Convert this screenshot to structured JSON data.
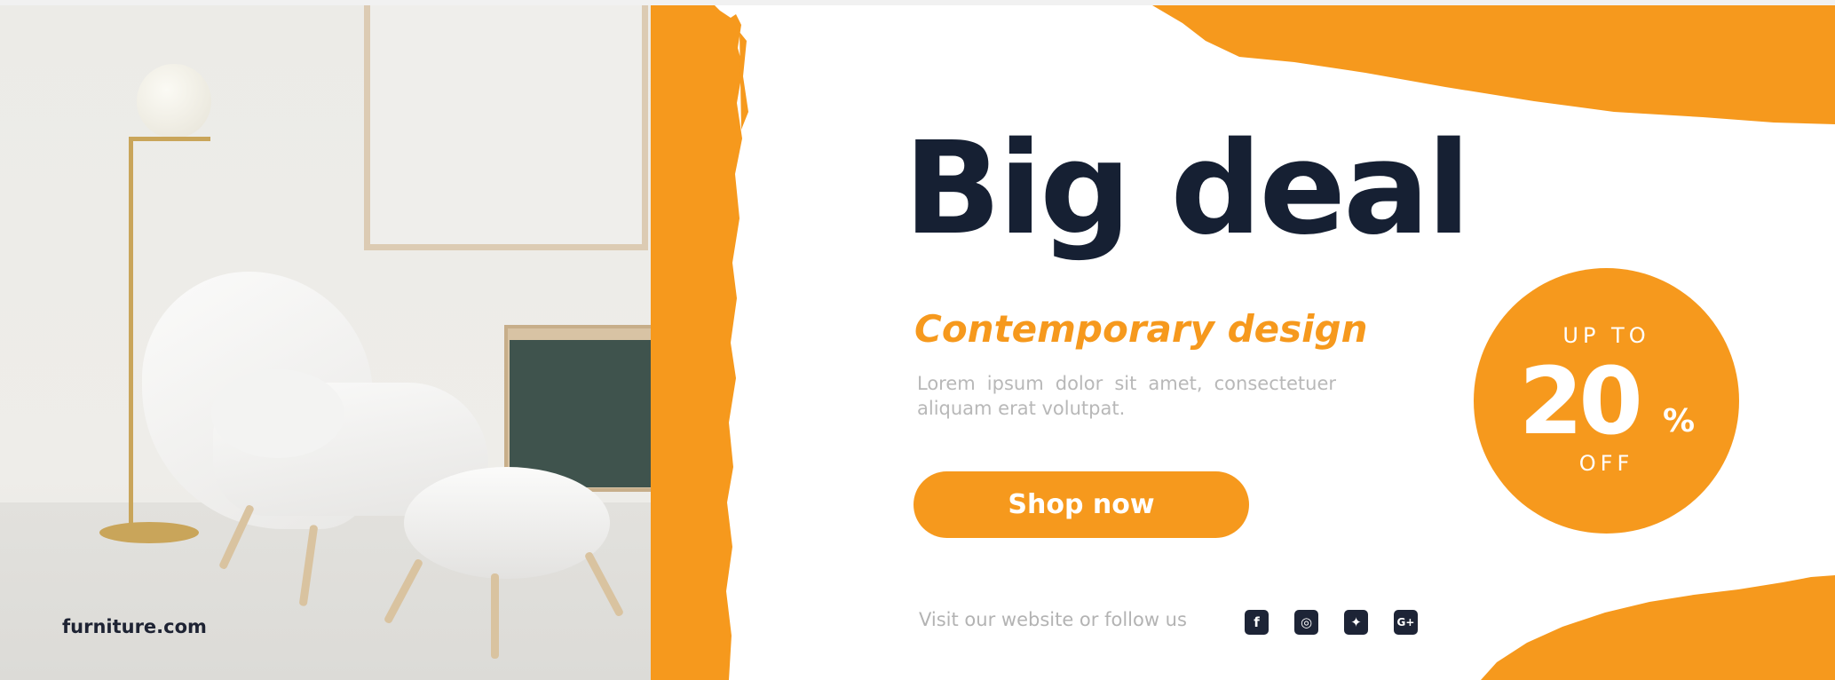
{
  "banner": {
    "headline": "Big deal",
    "subheadline": "Contemporary design",
    "body_text": "Lorem ipsum dolor sit amet, consectetuer aliquam erat volutpat.",
    "cta_label": "Shop now",
    "footer_text": "Visit our website or follow us",
    "brand": "furniture.com"
  },
  "badge": {
    "top_text": "UP TO",
    "number": "20",
    "percent": "%",
    "bottom_text": "OFF"
  },
  "social": [
    {
      "icon": "facebook-icon",
      "glyph": "f"
    },
    {
      "icon": "instagram-icon",
      "glyph": "◎"
    },
    {
      "icon": "twitter-icon",
      "glyph": "✦"
    },
    {
      "icon": "google-plus-icon",
      "glyph": "G+"
    }
  ],
  "colors": {
    "accent": "#f6991d",
    "headline": "#162033",
    "body_text": "#b8b8b8",
    "icon_bg": "#1d2436",
    "cabinet_door": "#3f534d"
  }
}
